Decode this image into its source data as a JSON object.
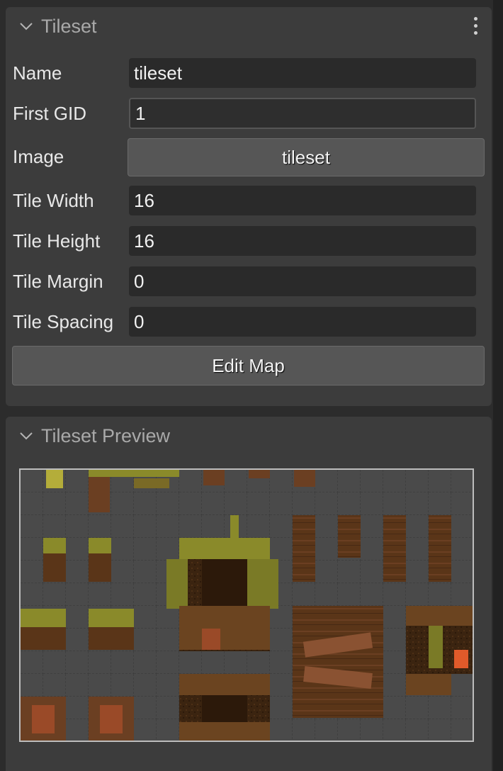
{
  "tileset_panel": {
    "title": "Tileset",
    "chevron_icon": "chevron-down-icon",
    "menu_icon": "more-vertical-icon",
    "fields": {
      "name_label": "Name",
      "name_value": "tileset",
      "first_gid_label": "First GID",
      "first_gid_value": "1",
      "image_label": "Image",
      "image_button": "tileset",
      "tile_width_label": "Tile Width",
      "tile_width_value": "16",
      "tile_height_label": "Tile Height",
      "tile_height_value": "16",
      "tile_margin_label": "Tile Margin",
      "tile_margin_value": "0",
      "tile_spacing_label": "Tile Spacing",
      "tile_spacing_value": "0"
    },
    "edit_map_button": "Edit Map"
  },
  "preview_panel": {
    "title": "Tileset Preview",
    "chevron_icon": "chevron-down-icon"
  },
  "colors": {
    "panel_bg": "#3c3c3c",
    "field_bg": "#2a2a2a",
    "button_bg": "#565656",
    "grid_bg": "#4a4a4a",
    "tile_dark": "#3b2410",
    "tile_mid": "#5a3518",
    "tile_wood": "#6b3f22",
    "foliage": "#8a8a2a",
    "foliage_light": "#b4ad3a",
    "lantern": "#e05a2a"
  }
}
